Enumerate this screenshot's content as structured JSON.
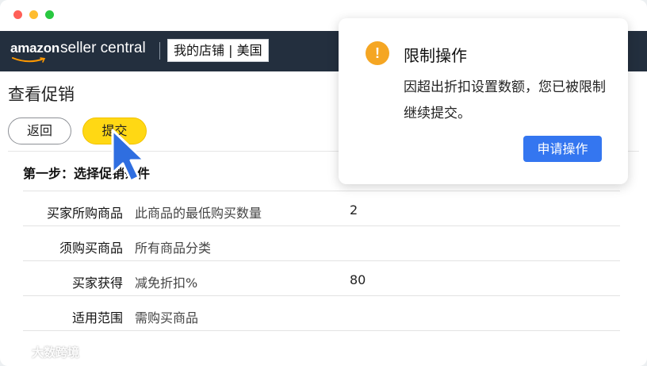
{
  "header": {
    "brand": "amazon",
    "brand_sub": "seller central",
    "store": "我的店铺 | 美国"
  },
  "page": {
    "title": "查看促销",
    "back_label": "返回",
    "submit_label": "提交"
  },
  "step": {
    "title": "第一步：选择促销条件"
  },
  "rows": [
    {
      "label": "买家所购商品",
      "desc": "此商品的最低购买数量",
      "value": "2"
    },
    {
      "label": "须购买商品",
      "desc": "所有商品分类",
      "value": ""
    },
    {
      "label": "买家获得",
      "desc": "减免折扣%",
      "value": "80"
    },
    {
      "label": "适用范围",
      "desc": "需购买商品",
      "value": ""
    }
  ],
  "dialog": {
    "title": "限制操作",
    "message": "因超出折扣设置数额，您已被限制继续提交。",
    "button": "申请操作",
    "icon": "warning-icon"
  },
  "watermark": {
    "text": "大数跨境"
  },
  "colors": {
    "nav_bg": "#232f3e",
    "submit_bg": "#ffd814",
    "dialog_button": "#3476f0",
    "warning": "#f5a623",
    "cursor": "#2f6ee0"
  }
}
